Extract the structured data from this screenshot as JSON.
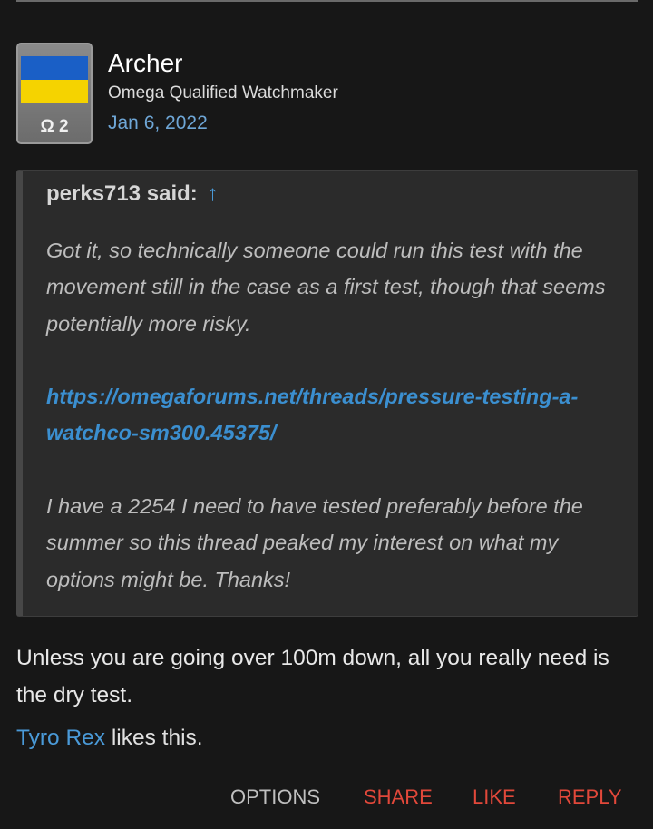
{
  "post": {
    "author": {
      "name": "Archer",
      "title": "Omega Qualified Watchmaker",
      "avatar_badge": "Ω 2",
      "avatar_flag_colors": [
        "#1a5fc6",
        "#f5d300"
      ]
    },
    "date": "Jan 6, 2022",
    "quote": {
      "author_label": "perks713 said:",
      "jump_arrow": "↑",
      "paragraph1": "Got it, so technically someone could run this test with the movement still in the case as a first test, though that seems potentially more risky.",
      "link_text": "https://omegaforums.net/threads/pressure-testing-a-watchco-sm300.45375/",
      "paragraph2": "I have a 2254 I need to have tested preferably before the summer so this thread peaked my interest on what my options might be. Thanks!"
    },
    "body": "Unless you are going over 100m down, all you really need is the dry test.",
    "likes": {
      "liker": "Tyro Rex",
      "suffix": " likes this."
    },
    "actions": {
      "options": "OPTIONS",
      "share": "SHARE",
      "like": "LIKE",
      "reply": "REPLY"
    }
  },
  "colors": {
    "background": "#171717",
    "accent_link": "#4a9ad8",
    "action_red": "#e2483a"
  }
}
